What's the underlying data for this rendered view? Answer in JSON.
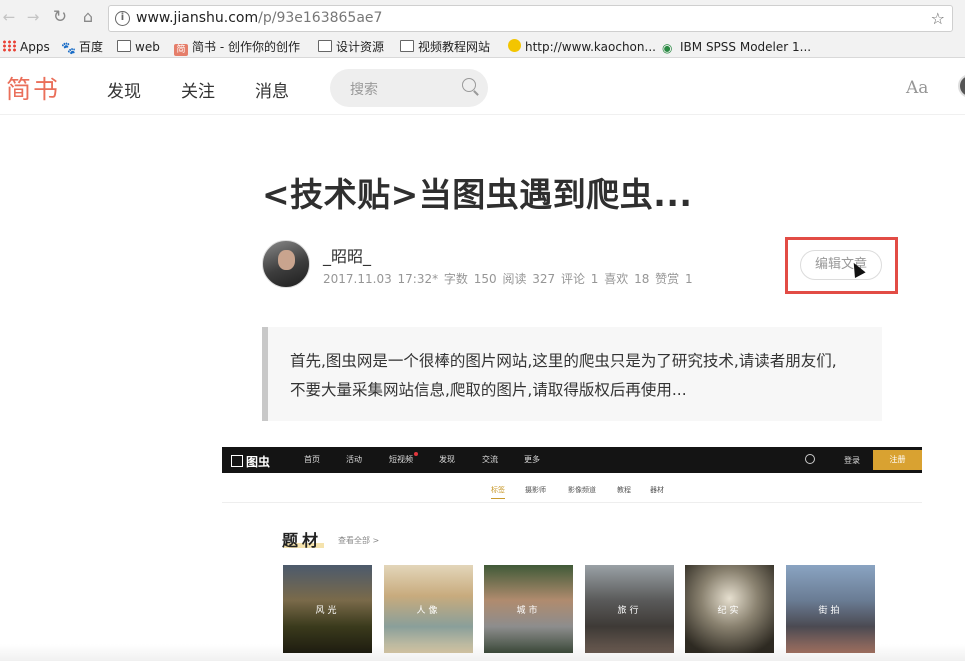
{
  "browser": {
    "url_host": "www.jianshu.com",
    "url_path": "/p/93e163865ae7",
    "bookmarks": [
      {
        "label": "Apps",
        "icon": "apps-grid-icon"
      },
      {
        "label": "百度",
        "icon": "baidu-paw-icon"
      },
      {
        "label": "web",
        "icon": "folder-icon"
      },
      {
        "label": "简书 - 创作你的创作",
        "icon": "jianshu-icon"
      },
      {
        "label": "设计资源",
        "icon": "folder-icon"
      },
      {
        "label": "视频教程网站",
        "icon": "folder-icon"
      },
      {
        "label": "http://www.kaochon...",
        "icon": "smiley-icon"
      },
      {
        "label": "IBM SPSS Modeler 1...",
        "icon": "ibm-icon"
      }
    ]
  },
  "header": {
    "logo": "简书",
    "nav": [
      "发现",
      "关注",
      "消息"
    ],
    "search_placeholder": "搜索",
    "font_toggle": "Aa"
  },
  "article": {
    "title": "<技术贴>当图虫遇到爬虫...",
    "author": "_昭昭_",
    "meta": "2017.11.03 17:32* 字数 150 阅读 327 评论 1 喜欢 18 赞赏 1",
    "edit_label": "编辑文章",
    "quote_line1": "首先,图虫网是一个很棒的图片网站,这里的爬虫只是为了研究技术,请读者朋友们,",
    "quote_line2": "不要大量采集网站信息,爬取的图片,请取得版权后再使用..."
  },
  "embedded": {
    "logo": "图虫",
    "nav": [
      "首页",
      "活动",
      "短视频",
      "发现",
      "交流",
      "更多"
    ],
    "login": "登录",
    "register": "注册",
    "tabs": [
      "标签",
      "摄影师",
      "影像频道",
      "教程",
      "器材"
    ],
    "section_title": "题材",
    "view_all": "查看全部 >",
    "thumbs": [
      "风光",
      "人像",
      "城市",
      "旅行",
      "纪实",
      "街拍"
    ]
  },
  "colors": {
    "brand": "#ea6f5a",
    "highlight": "#e24c45",
    "tuchong_gold": "#d9a231"
  }
}
